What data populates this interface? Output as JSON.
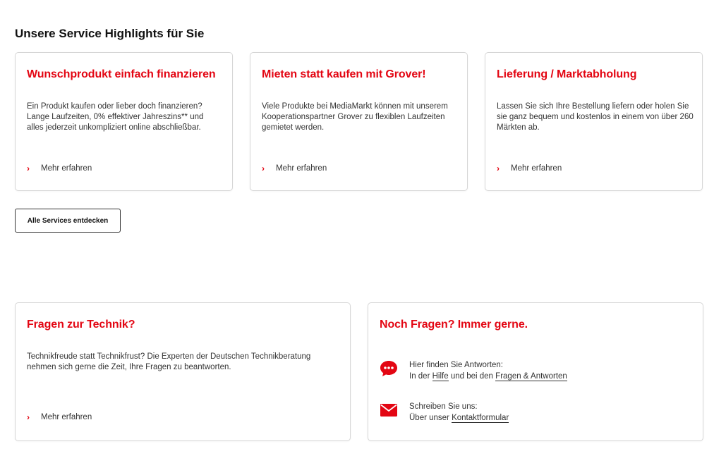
{
  "section": {
    "title": "Unsere Service Highlights für Sie"
  },
  "cards": [
    {
      "title": "Wunschprodukt einfach finanzieren",
      "text": "Ein Produkt kaufen oder lieber doch finanzieren? Lange Laufzeiten, 0% effektiver Jahreszins** und alles jederzeit unkompliziert online abschließbar.",
      "link": "Mehr erfahren"
    },
    {
      "title": "Mieten statt kaufen mit Grover!",
      "text": "Viele Produkte bei MediaMarkt können mit unserem Kooperationspartner Grover zu flexiblen Laufzeiten gemietet werden.",
      "link": "Mehr erfahren"
    },
    {
      "title": "Lieferung / Marktabholung",
      "text": "Lassen Sie sich Ihre Bestellung liefern oder holen Sie sie ganz bequem und kostenlos in einem von über 260 Märkten ab.",
      "link": "Mehr erfahren"
    }
  ],
  "all_services_button": "Alle Services entdecken",
  "technik": {
    "title": "Fragen zur Technik?",
    "text": "Technikfreude statt Technikfrust? Die Experten der Deutschen Technikberatung nehmen sich gerne die Zeit, Ihre Fragen zu beantworten.",
    "link": "Mehr erfahren"
  },
  "contact": {
    "title": "Noch Fragen? Immer gerne.",
    "answers_heading": "Hier finden Sie Antworten:",
    "answers_prefix": "In der",
    "help_link": "Hilfe",
    "answers_middle": "und bei den",
    "faq_link": "Fragen & Antworten",
    "write_heading": "Schreiben Sie uns:",
    "write_prefix": "Über unser",
    "form_link": "Kontaktformular"
  },
  "colors": {
    "accent": "#e30613",
    "border": "#d6d6d6",
    "text": "#333333"
  },
  "icons": {
    "more": "chevron-right-icon",
    "chat": "chat-bubble-icon",
    "mail": "envelope-icon"
  }
}
